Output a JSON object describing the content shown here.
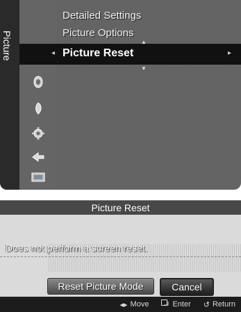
{
  "menu": {
    "category_title": "Picture",
    "items": [
      {
        "label": "Detailed Settings"
      },
      {
        "label": "Picture Options"
      },
      {
        "label": "Picture Reset"
      }
    ],
    "selected_index": 2,
    "icons": [
      "picture-icon",
      "sound-icon",
      "channel-icon",
      "setup-icon",
      "input-icon",
      "application-icon"
    ]
  },
  "dialog": {
    "title": "Picture Reset",
    "message": "Does not perform a screen reset.",
    "buttons": [
      {
        "label": "Reset Picture Mode"
      },
      {
        "label": "Cancel",
        "selected": true
      }
    ]
  },
  "footer": {
    "hints": [
      {
        "icon": "left-right-arrows-icon",
        "label": "Move"
      },
      {
        "icon": "enter-icon",
        "label": "Enter"
      },
      {
        "icon": "return-icon",
        "label": "Return"
      }
    ]
  }
}
